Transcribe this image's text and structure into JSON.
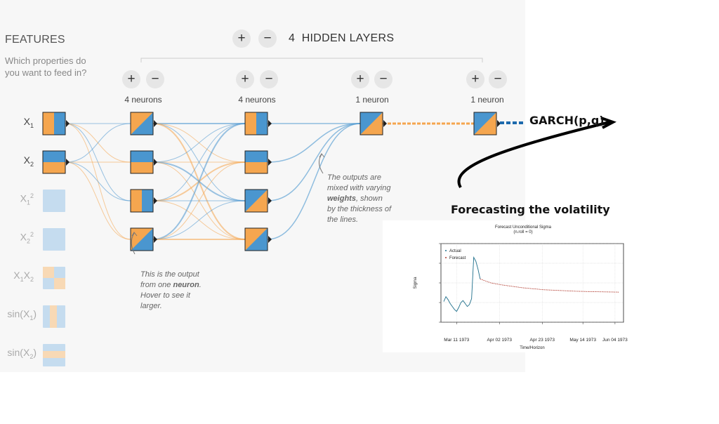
{
  "features": {
    "title": "FEATURES",
    "subtitle": "Which properties do you want to feed in?",
    "items": [
      {
        "base": "X",
        "sub": "1",
        "sup": "",
        "active": true
      },
      {
        "base": "X",
        "sub": "2",
        "sup": "",
        "active": true
      },
      {
        "base": "X",
        "sub": "1",
        "sup": "2",
        "active": false
      },
      {
        "base": "X",
        "sub": "2",
        "sup": "2",
        "active": false
      },
      {
        "base": "X",
        "sub": "1",
        "sup": "",
        "extra_base": "X",
        "extra_sub": "2",
        "active": false
      },
      {
        "base": "sin(X",
        "sub": "1",
        "sup": "",
        "tail": ")",
        "active": false
      },
      {
        "base": "sin(X",
        "sub": "2",
        "sup": "",
        "tail": ")",
        "active": false
      }
    ]
  },
  "hidden_layers": {
    "count": "4",
    "label": "HIDDEN LAYERS",
    "add_glyph": "+",
    "remove_glyph": "−",
    "layers": [
      {
        "neurons_label": "4 neurons"
      },
      {
        "neurons_label": "4 neurons"
      },
      {
        "neurons_label": "1 neuron"
      },
      {
        "neurons_label": "1 neuron"
      }
    ]
  },
  "annotations": {
    "neuron_note": [
      "This is the output",
      "from one ",
      "neuron",
      ". ",
      "Hover to see it",
      "larger."
    ],
    "weights_note": [
      "The outputs are",
      "mixed with varying",
      "weights",
      ", shown",
      "by the thickness of",
      "the lines."
    ]
  },
  "garch_label": "GARCH(p,q)",
  "forecast_title": "Forecasting the volatility",
  "chart_data": {
    "type": "line",
    "title": "Forecast Unconditional Sigma",
    "subtitle": "(n.roll = 0)",
    "xlabel": "Time/Horizon",
    "ylabel": "Sigma",
    "x_tick_labels": [
      "Mar 11 1973",
      "Apr 02 1973",
      "Apr 23 1973",
      "May 14 1973",
      "Jun 04 1973"
    ],
    "legend": [
      "Actual",
      "Forecast"
    ],
    "colors": {
      "actual": "#1f6f8b",
      "forecast": "#b03a2e"
    },
    "ylim": [
      1,
      9
    ],
    "y_ticks": [
      1,
      3,
      5,
      7,
      9
    ],
    "series": [
      {
        "name": "Actual",
        "x": [
          0,
          1,
          2,
          3,
          4,
          5,
          6,
          7,
          8,
          9,
          10,
          11,
          12,
          13,
          14,
          15,
          16,
          17
        ],
        "values": [
          3.1,
          3.6,
          3.3,
          2.9,
          2.6,
          2.3,
          2.1,
          2.5,
          3.0,
          3.2,
          2.9,
          2.6,
          2.8,
          3.4,
          7.6,
          7.2,
          6.4,
          5.4
        ]
      },
      {
        "name": "Forecast",
        "x": [
          17,
          22,
          27,
          32,
          37,
          42,
          47,
          52,
          57,
          62,
          67,
          72,
          77,
          82
        ],
        "values": [
          5.4,
          5.0,
          4.8,
          4.65,
          4.5,
          4.4,
          4.3,
          4.25,
          4.2,
          4.15,
          4.12,
          4.1,
          4.08,
          4.06
        ]
      }
    ]
  },
  "colors": {
    "orange": "#f5a64f",
    "blue": "#4a96cf",
    "dark_blue": "#1d6aad"
  }
}
